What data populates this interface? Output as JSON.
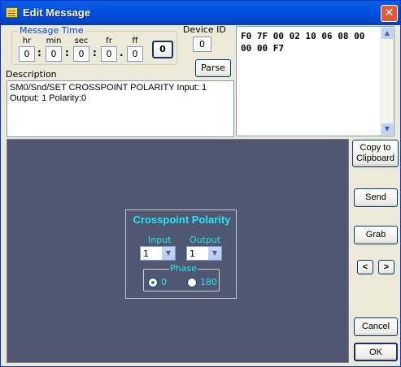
{
  "window": {
    "title": "Edit Message",
    "close_glyph": "✕"
  },
  "message_time": {
    "legend": "Message Time",
    "labels": [
      "hr",
      "min",
      "sec",
      "fr",
      "ff"
    ],
    "values": [
      "0",
      "0",
      "0",
      "0",
      "0"
    ],
    "separators": [
      ":",
      ":",
      ":",
      "."
    ],
    "button_label": "0"
  },
  "device": {
    "label": "Device ID",
    "value": "0"
  },
  "parse_label": "Parse",
  "description": {
    "label": "Description",
    "text": "SM0/Snd/SET CROSSPOINT POLARITY Input: 1 Output: 1 Polarity:0"
  },
  "hex": {
    "text": "F0 7F 00 02 10 06 08 00 00 00 F7"
  },
  "crosspoint": {
    "title": "Crosspoint Polarity",
    "input_label": "Input",
    "input_value": "1",
    "output_label": "Output",
    "output_value": "1",
    "phase_label": "Phase",
    "phase_options": [
      "0",
      "180"
    ],
    "phase_selected": "0"
  },
  "buttons": {
    "copy_line1": "Copy to",
    "copy_line2": "Clipboard",
    "send": "Send",
    "grab": "Grab",
    "prev": "<",
    "next": ">",
    "cancel": "Cancel",
    "ok": "OK"
  },
  "colors": {
    "panel_bg": "#4F5772",
    "cyan_text": "#25E8F0",
    "titlebar": "#0053E1"
  },
  "icons": [
    "message-icon",
    "close-icon",
    "scroll-up-icon",
    "scroll-down-icon",
    "dropdown-arrow-icon"
  ]
}
